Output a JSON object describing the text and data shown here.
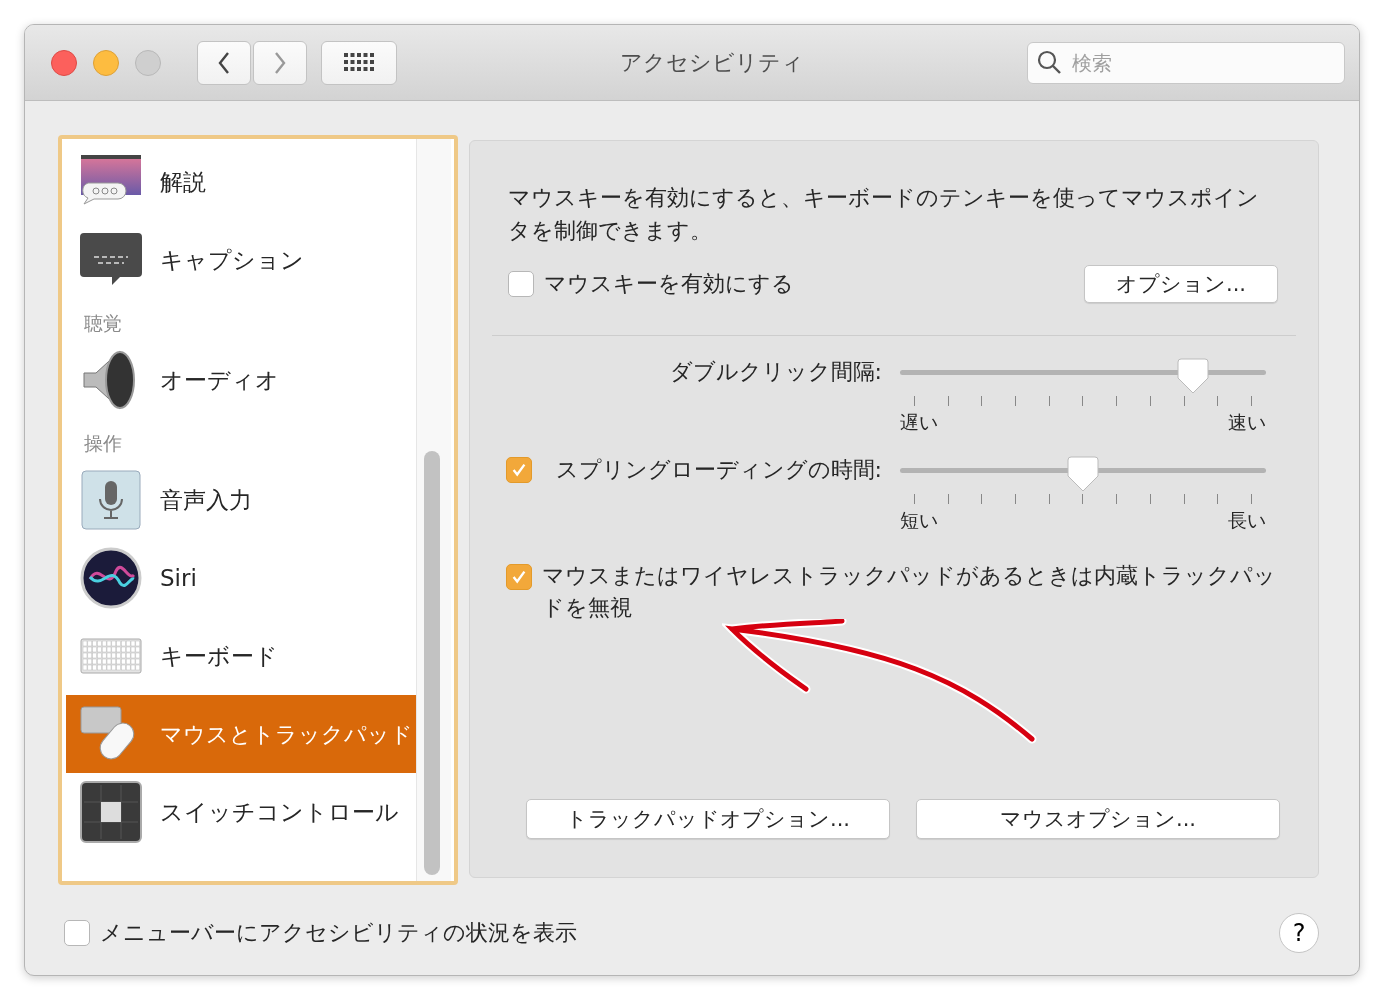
{
  "window": {
    "title": "アクセシビリティ"
  },
  "search": {
    "placeholder": "検索"
  },
  "sidebar": {
    "items": [
      {
        "kind": "item",
        "label": "解説",
        "selected": false
      },
      {
        "kind": "item",
        "label": "キャプション",
        "selected": false
      },
      {
        "kind": "section",
        "label": "聴覚"
      },
      {
        "kind": "item",
        "label": "オーディオ",
        "selected": false
      },
      {
        "kind": "section",
        "label": "操作"
      },
      {
        "kind": "item",
        "label": "音声入力",
        "selected": false
      },
      {
        "kind": "item",
        "label": "Siri",
        "selected": false
      },
      {
        "kind": "item",
        "label": "キーボード",
        "selected": false
      },
      {
        "kind": "item",
        "label": "マウスとトラックパッド",
        "selected": true
      },
      {
        "kind": "item",
        "label": "スイッチコントロール",
        "selected": false
      }
    ]
  },
  "panel": {
    "description": "マウスキーを有効にすると、キーボードのテンキーを使ってマウスポインタを制御できます。",
    "mouse_keys": {
      "label": "マウスキーを有効にする",
      "checked": false
    },
    "options_button": "オプション...",
    "sliders": [
      {
        "kind": "plain",
        "label": "ダブルクリック間隔:",
        "level": 0.8,
        "min_label": "遅い",
        "max_label": "速い"
      },
      {
        "kind": "checkbox",
        "label": "スプリングローディングの時間:",
        "checked": true,
        "level": 0.5,
        "min_label": "短い",
        "max_label": "長い"
      }
    ],
    "ignore_trackpad": {
      "label": "マウスまたはワイヤレストラックパッドがあるときは内蔵トラックパッドを無視",
      "checked": true
    },
    "buttons": [
      "トラックパッドオプション...",
      "マウスオプション..."
    ]
  },
  "footer": {
    "menu_bar_status": {
      "label": "メニューバーにアクセシビリティの状況を表示",
      "checked": false
    },
    "help": "?"
  }
}
